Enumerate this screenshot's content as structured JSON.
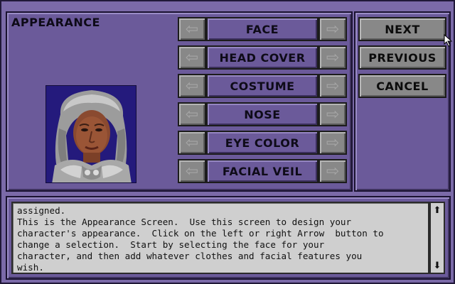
{
  "screen": {
    "title": "APPEARANCE"
  },
  "features": [
    {
      "label": "FACE"
    },
    {
      "label": "HEAD COVER"
    },
    {
      "label": "COSTUME"
    },
    {
      "label": "NOSE"
    },
    {
      "label": "EYE COLOR"
    },
    {
      "label": "FACIAL VEIL"
    }
  ],
  "arrows": {
    "left_icon": "left-arrow-icon",
    "right_icon": "right-arrow-icon",
    "left_glyph": "⇦",
    "right_glyph": "⇨"
  },
  "menu": {
    "next": "NEXT",
    "previous": "PREVIOUS",
    "cancel": "CANCEL"
  },
  "message": {
    "lines": [
      "assigned.",
      "This is the Appearance Screen.  Use this screen to design your",
      "character's appearance.  Click on the left or right Arrow  button to",
      "change a selection.  Start by selecting the face for your",
      "character, and then add whatever clothes and facial features you",
      "wish."
    ]
  },
  "scroll": {
    "up_glyph": "⬆",
    "down_glyph": "⬇"
  },
  "colors": {
    "background": "#7b6aa8",
    "panel": "#6b5a9a",
    "button_gray": "#888888",
    "text_area": "#cfcfcf",
    "portrait_bg": "#231a78"
  }
}
